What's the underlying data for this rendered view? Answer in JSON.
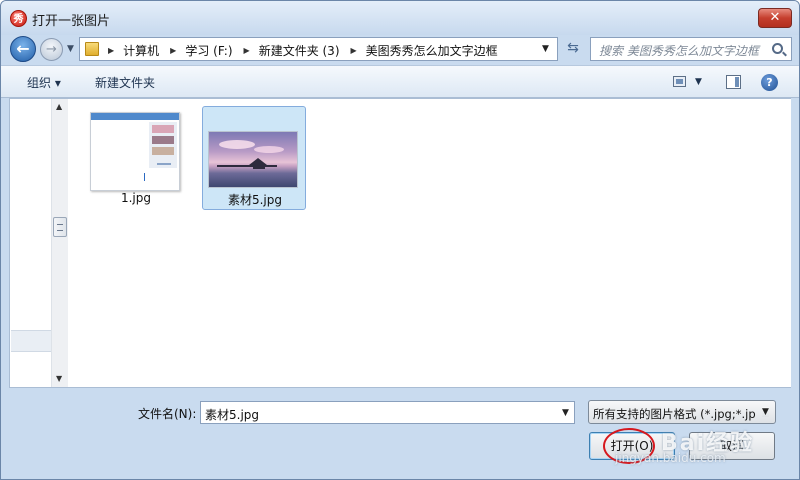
{
  "window": {
    "title": "打开一张图片",
    "app_icon_glyph": "秀"
  },
  "navigation": {
    "breadcrumbs": [
      "计算机",
      "学习 (F:)",
      "新建文件夹 (3)",
      "美图秀秀怎么加文字边框"
    ],
    "search_placeholder": "搜索 美图秀秀怎么加文字边框"
  },
  "toolbar": {
    "organize_label": "组织 ▾",
    "new_folder_label": "新建文件夹"
  },
  "files": [
    {
      "name": "1.jpg",
      "selected": false
    },
    {
      "name": "素材5.jpg",
      "selected": true
    }
  ],
  "footer": {
    "filename_label": "文件名(N):",
    "filename_value": "素材5.jpg",
    "filter_value": "所有支持的图片格式 (*.jpg;*.jp",
    "open_label": "打开(O)",
    "cancel_label": "取消"
  },
  "watermark": {
    "text": "Bai经验",
    "url": "jingyan.baidu.com"
  },
  "colors": {
    "accent": "#cde6f7",
    "highlight_ring": "#d6181e",
    "close": "#c53f2e"
  }
}
